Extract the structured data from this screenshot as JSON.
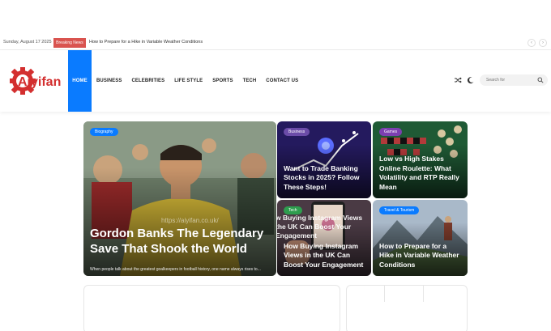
{
  "topbar": {
    "date": "Sunday, August 17 2025",
    "breaking_label": "Breaking News",
    "ticker": "How to Prepare for a Hike in Variable Weather Conditions",
    "prev": "‹",
    "next": "›"
  },
  "logo": {
    "text": "Aiyifan"
  },
  "nav": {
    "items": [
      "HOME",
      "BUSINESS",
      "CELEBRITIES",
      "LIFE STYLE",
      "SPORTS",
      "TECH",
      "CONTACT US"
    ],
    "active": "HOME"
  },
  "search": {
    "placeholder": "Search for"
  },
  "colors": {
    "accent": "#0a7bff",
    "breaking": "#d9534f",
    "badge_sports": "#0a7bff",
    "badge_business": "#6b4ca8",
    "badge_games": "#7c3fb0",
    "badge_tech": "#2e9d4e",
    "badge_travel": "#0a7bff"
  },
  "hero": {
    "badge": "Biography",
    "title": "Gordon Banks The Legendary Save That Shook the World",
    "excerpt": "When people talk about the greatest goalkeepers in football history, one name always rises to...",
    "watermark": "https://aiyifan.co.uk/"
  },
  "cards": [
    {
      "badge": "Business",
      "title": "Want to Trade Banking Stocks in 2025? Follow These Steps!"
    },
    {
      "badge": "Games",
      "title": "Low vs High Stakes Online Roulette: What Volatility and RTP Really Mean"
    },
    {
      "badge": "Tech",
      "title": "How Buying Instagram Views in the UK Can Boost Your Engagement",
      "overlay": "w Buying Instagram Views the UK Can Boost Your Engagement"
    },
    {
      "badge": "Travel & Tourism",
      "title": "How to Prepare for a Hike in Variable Weather Conditions"
    }
  ]
}
